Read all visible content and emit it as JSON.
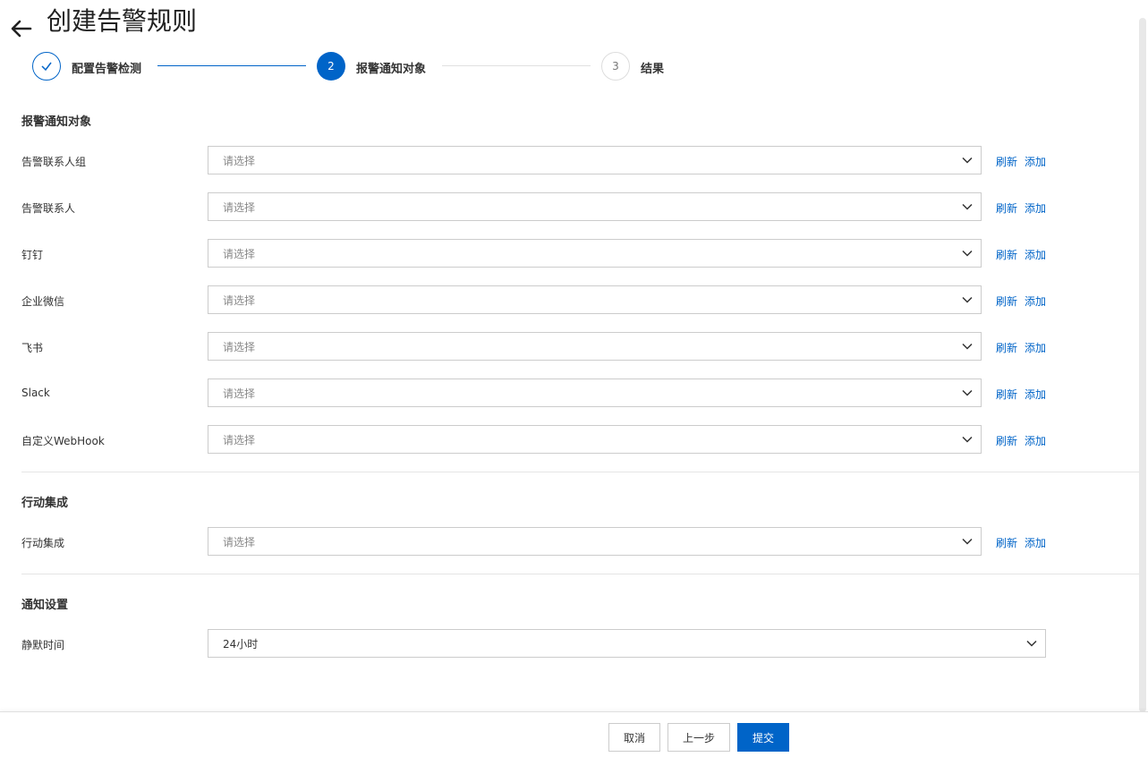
{
  "page": {
    "title": "创建告警规则"
  },
  "steps": [
    {
      "number": "",
      "label": "配置告警检测",
      "state": "done"
    },
    {
      "number": "2",
      "label": "报警通知对象",
      "state": "active"
    },
    {
      "number": "3",
      "label": "结果",
      "state": "pending"
    }
  ],
  "colors": {
    "primary": "#0064c8",
    "link": "#0064c8",
    "border": "#cccccc"
  },
  "sections": {
    "notify": {
      "title": "报警通知对象",
      "rows": [
        {
          "label": "告警联系人组",
          "placeholder": "请选择",
          "refresh": "刷新",
          "add": "添加"
        },
        {
          "label": "告警联系人",
          "placeholder": "请选择",
          "refresh": "刷新",
          "add": "添加"
        },
        {
          "label": "钉钉",
          "placeholder": "请选择",
          "refresh": "刷新",
          "add": "添加"
        },
        {
          "label": "企业微信",
          "placeholder": "请选择",
          "refresh": "刷新",
          "add": "添加"
        },
        {
          "label": "飞书",
          "placeholder": "请选择",
          "refresh": "刷新",
          "add": "添加"
        },
        {
          "label": "Slack",
          "placeholder": "请选择",
          "refresh": "刷新",
          "add": "添加"
        },
        {
          "label": "自定义WebHook",
          "placeholder": "请选择",
          "refresh": "刷新",
          "add": "添加"
        }
      ]
    },
    "action": {
      "title": "行动集成",
      "rows": [
        {
          "label": "行动集成",
          "placeholder": "请选择",
          "refresh": "刷新",
          "add": "添加"
        }
      ]
    },
    "settings": {
      "title": "通知设置",
      "silence": {
        "label": "静默时间",
        "value": "24小时"
      }
    }
  },
  "footer": {
    "cancel": "取消",
    "prev": "上一步",
    "submit": "提交"
  },
  "icons": {
    "back": "arrow-left-icon",
    "check": "check-icon",
    "chevron": "chevron-down-icon"
  }
}
